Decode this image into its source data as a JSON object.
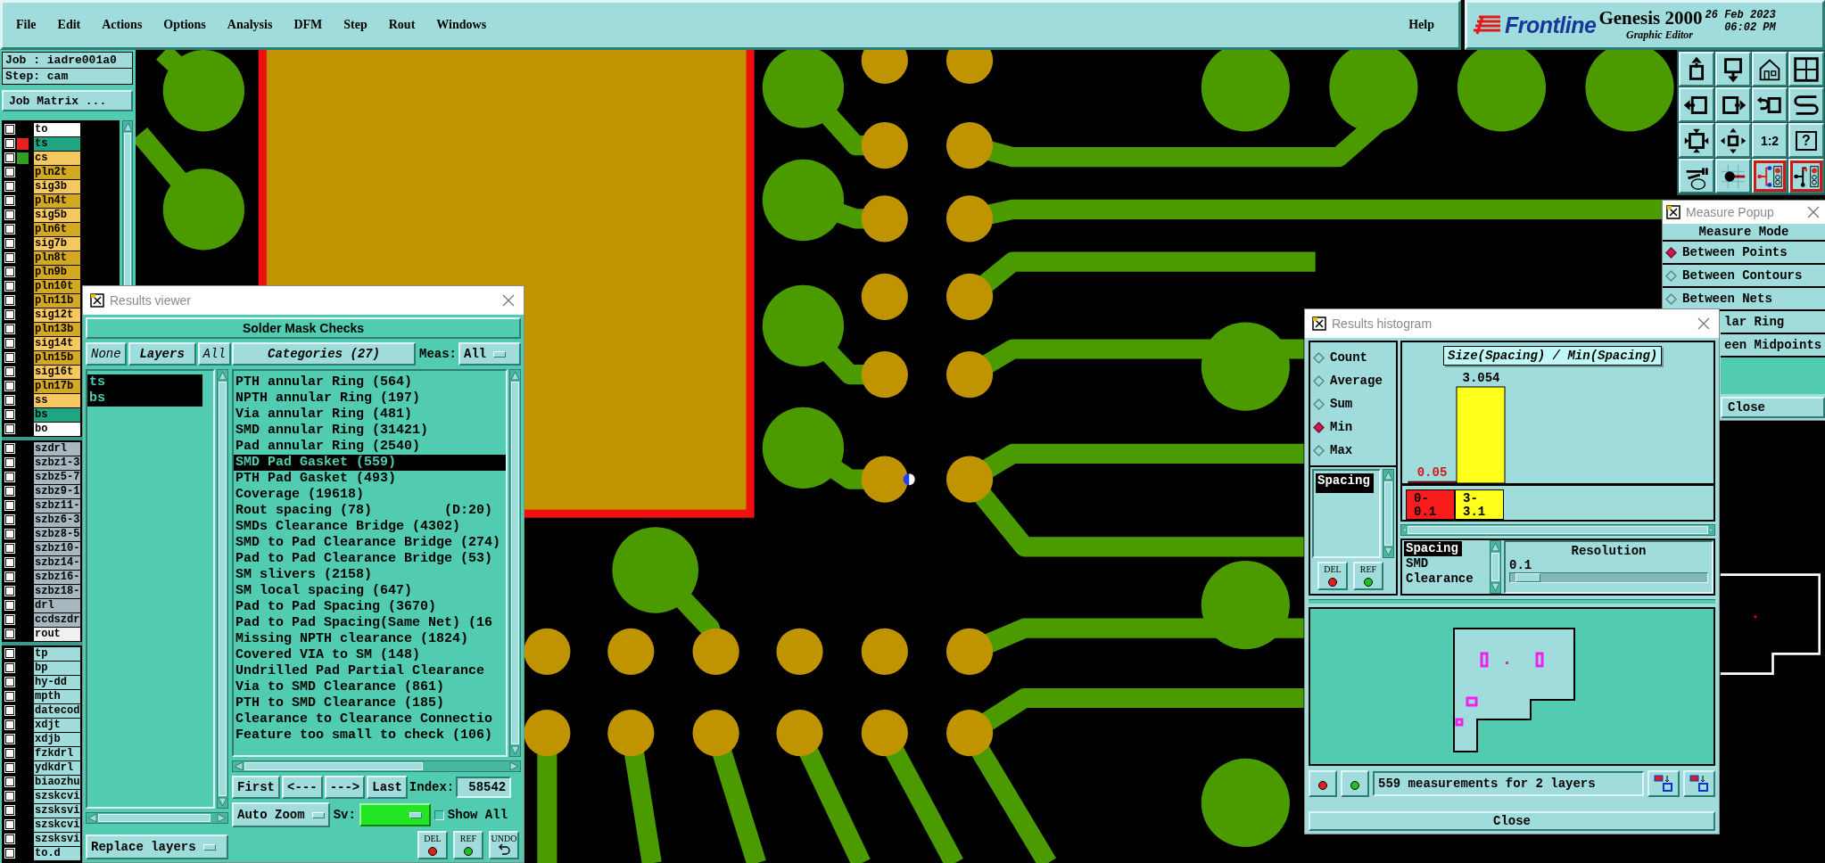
{
  "menubar": {
    "items": [
      "File",
      "Edit",
      "Actions",
      "Options",
      "Analysis",
      "DFM",
      "Step",
      "Rout",
      "Windows"
    ],
    "help": "Help"
  },
  "logo": {
    "brand": "Frontline",
    "product": "Genesis 2000",
    "subtitle": "Graphic Editor",
    "date": "26 Feb 2023",
    "time": "06:02 PM"
  },
  "job_panel": {
    "job": "Job : iadre001a0",
    "step": "Step: cam",
    "matrix_button": "Job Matrix ..."
  },
  "layer_groups": [
    {
      "layers": [
        {
          "name": "to",
          "color": "#ffffff",
          "checked": false
        },
        {
          "name": "ts",
          "color": "#1fa582",
          "checked": false,
          "display": {
            "color": "#e82020"
          }
        },
        {
          "name": "cs",
          "color": "#f8c860",
          "checked": false,
          "display": {
            "color": "#30a020"
          }
        },
        {
          "name": "pln2t",
          "color": "#d4a820",
          "checked": false
        },
        {
          "name": "sig3b",
          "color": "#f8c860",
          "checked": false
        },
        {
          "name": "pln4t",
          "color": "#d4a820",
          "checked": false
        },
        {
          "name": "sig5b",
          "color": "#f8c860",
          "checked": false
        },
        {
          "name": "pln6t",
          "color": "#d4a820",
          "checked": false
        },
        {
          "name": "sig7b",
          "color": "#f8c860",
          "checked": false
        },
        {
          "name": "pln8t",
          "color": "#d4a820",
          "checked": false
        },
        {
          "name": "pln9b",
          "color": "#d4a820",
          "checked": false
        },
        {
          "name": "pln10t",
          "color": "#d4a820",
          "checked": false
        },
        {
          "name": "pln11b",
          "color": "#d4a820",
          "checked": false
        },
        {
          "name": "sig12t",
          "color": "#f8c860",
          "checked": false
        },
        {
          "name": "pln13b",
          "color": "#d4a820",
          "checked": false
        },
        {
          "name": "sig14t",
          "color": "#f8c860",
          "checked": false
        },
        {
          "name": "pln15b",
          "color": "#d4a820",
          "checked": false
        },
        {
          "name": "sig16t",
          "color": "#f8c860",
          "checked": false
        },
        {
          "name": "pln17b",
          "color": "#d4a820",
          "checked": false
        },
        {
          "name": "ss",
          "color": "#f8c860",
          "checked": false
        },
        {
          "name": "bs",
          "color": "#1fa582",
          "checked": false
        },
        {
          "name": "bo",
          "color": "#ffffff",
          "checked": false
        }
      ]
    },
    {
      "layers": [
        {
          "name": "szdrl",
          "color": "#a8b8c0",
          "checked": false
        },
        {
          "name": "szbz1-3",
          "color": "#a8b8c0",
          "checked": false
        },
        {
          "name": "szbz5-7",
          "color": "#a8b8c0",
          "checked": false
        },
        {
          "name": "szbz9-1",
          "color": "#a8b8c0",
          "checked": false
        },
        {
          "name": "szbz11-",
          "color": "#a8b8c0",
          "checked": false
        },
        {
          "name": "szbz6-3",
          "color": "#a8b8c0",
          "checked": false
        },
        {
          "name": "szbz8-5",
          "color": "#a8b8c0",
          "checked": false
        },
        {
          "name": "szbz10-",
          "color": "#a8b8c0",
          "checked": false
        },
        {
          "name": "szbz14-",
          "color": "#a8b8c0",
          "checked": false
        },
        {
          "name": "szbz16-",
          "color": "#a8b8c0",
          "checked": false
        },
        {
          "name": "szbz18-",
          "color": "#a8b8c0",
          "checked": false
        },
        {
          "name": "drl",
          "color": "#a8b8c0",
          "checked": false
        },
        {
          "name": "ccdszdr",
          "color": "#a8b8c0",
          "checked": false
        },
        {
          "name": "rout",
          "color": "#f0f0f0",
          "checked": false
        }
      ]
    },
    {
      "layers": [
        {
          "name": "tp",
          "color": "#a0dcdc",
          "checked": false
        },
        {
          "name": "bp",
          "color": "#a0dcdc",
          "checked": false
        },
        {
          "name": "hy-dd",
          "color": "#a0dcdc",
          "checked": false
        },
        {
          "name": "mpth",
          "color": "#a0dcdc",
          "checked": false
        },
        {
          "name": "datecod",
          "color": "#a0dcdc",
          "checked": false
        },
        {
          "name": "xdjt",
          "color": "#a0dcdc",
          "checked": false
        },
        {
          "name": "xdjb",
          "color": "#a0dcdc",
          "checked": false
        },
        {
          "name": "fzkdrl",
          "color": "#a0dcdc",
          "checked": false
        },
        {
          "name": "ydkdrl",
          "color": "#a0dcdc",
          "checked": false
        },
        {
          "name": "biaozhu",
          "color": "#a0dcdc",
          "checked": false
        },
        {
          "name": "szskcvi",
          "color": "#a0dcdc",
          "checked": false
        },
        {
          "name": "szsksvi",
          "color": "#a0dcdc",
          "checked": false
        },
        {
          "name": "szskcvi",
          "color": "#a0dcdc",
          "checked": false
        },
        {
          "name": "szsksvi",
          "color": "#a0dcdc",
          "checked": false
        },
        {
          "name": "to.d",
          "color": "#a0dcdc",
          "checked": false
        }
      ]
    }
  ],
  "toolbar": [
    {
      "kind": "box-up"
    },
    {
      "kind": "box-down"
    },
    {
      "kind": "home"
    },
    {
      "kind": "grid"
    },
    {
      "kind": "box-left"
    },
    {
      "kind": "box-right"
    },
    {
      "kind": "return"
    },
    {
      "kind": "s-curve"
    },
    {
      "kind": "fit"
    },
    {
      "kind": "center"
    },
    {
      "kind": "ratio",
      "label": "1:2"
    },
    {
      "kind": "help",
      "label": "?"
    },
    {
      "kind": "tools"
    },
    {
      "kind": "pin"
    },
    {
      "kind": "net-color"
    },
    {
      "kind": "net-mono"
    }
  ],
  "results_viewer": {
    "title": "Results viewer",
    "heading": "Solder Mask Checks",
    "layer_buttons": [
      "None",
      "Layers",
      "All"
    ],
    "layers": [
      {
        "name": "ts",
        "selected": true
      },
      {
        "name": "bs",
        "selected": true
      }
    ],
    "categories_button": "Categories (27)",
    "meas": {
      "label": "Meas:",
      "value": "All"
    },
    "categories": [
      {
        "label": "PTH annular Ring (564)",
        "selected": false
      },
      {
        "label": "NPTH annular Ring (197)",
        "selected": false
      },
      {
        "label": "Via annular Ring (481)",
        "selected": false
      },
      {
        "label": "SMD annular Ring (31421)",
        "selected": false
      },
      {
        "label": "Pad annular Ring (2540)",
        "selected": false
      },
      {
        "label": "SMD Pad Gasket (559)",
        "selected": true
      },
      {
        "label": "PTH Pad Gasket (493)",
        "selected": false
      },
      {
        "label": "Coverage (19618)",
        "selected": false
      },
      {
        "label": "Rout spacing (78)         (D:20)",
        "selected": false
      },
      {
        "label": "SMDs Clearance Bridge (4302)",
        "selected": false
      },
      {
        "label": "SMD to Pad Clearance Bridge (274)",
        "selected": false
      },
      {
        "label": "Pad to Pad Clearance Bridge (53)",
        "selected": false
      },
      {
        "label": "SM slivers (2158)",
        "selected": false
      },
      {
        "label": "SM local spacing (647)",
        "selected": false
      },
      {
        "label": "Pad to Pad Spacing (3670)",
        "selected": false
      },
      {
        "label": "Pad to Pad Spacing(Same Net) (16",
        "selected": false
      },
      {
        "label": "Missing NPTH clearance (1824)",
        "selected": false
      },
      {
        "label": "Covered VIA to SM (148)",
        "selected": false
      },
      {
        "label": "Undrilled Pad Partial Clearance",
        "selected": false
      },
      {
        "label": "Via to SMD Clearance (861)",
        "selected": false
      },
      {
        "label": "PTH to SMD Clearance (185)",
        "selected": false
      },
      {
        "label": "Clearance to Clearance Connectio",
        "selected": false
      },
      {
        "label": "Feature too small to check (106)",
        "selected": false
      }
    ],
    "nav": [
      "First",
      "<---",
      "--->",
      "Last"
    ],
    "index": {
      "label": "Index:",
      "value": "58542"
    },
    "zoom": "Auto Zoom",
    "sv": {
      "label": "Sv:",
      "color": "#22e622"
    },
    "show_all": {
      "label": "Show All",
      "checked": false
    },
    "replace": "Replace layers",
    "actions": [
      {
        "kind": "del",
        "label": "DEL"
      },
      {
        "kind": "ref",
        "label": "REF"
      },
      {
        "kind": "undo",
        "label": "UNDO"
      }
    ]
  },
  "results_histogram": {
    "title": "Results histogram",
    "modes": [
      {
        "label": "Count",
        "selected": false
      },
      {
        "label": "Average",
        "selected": false
      },
      {
        "label": "Sum",
        "selected": false
      },
      {
        "label": "Min",
        "selected": true
      },
      {
        "label": "Max",
        "selected": false
      }
    ],
    "measures": [
      {
        "label": "Spacing",
        "selected": true
      }
    ],
    "side_actions": [
      {
        "kind": "del",
        "label": "DEL"
      },
      {
        "kind": "ref",
        "label": "REF"
      }
    ],
    "chart": {
      "title": "Size(Spacing) / Min(Spacing)",
      "bins": [
        {
          "color": "#f81c1c"
        },
        {
          "color": "#ffff1c"
        }
      ],
      "chart_data": {
        "type": "bar",
        "categories": [
          "0- 0.1",
          "3- 3.1"
        ],
        "series": [
          {
            "values": [
              0.05,
              3.054
            ]
          }
        ],
        "data_labels": true
      }
    },
    "types": [
      {
        "label": "Spacing",
        "selected": true
      },
      {
        "label": "SMD",
        "selected": false
      },
      {
        "label": "Clearance",
        "selected": false
      }
    ],
    "resolution": {
      "title": "Resolution",
      "value": "0.1",
      "level": 0.03
    },
    "status": "559 measurements for 2 layers",
    "close": "Close"
  },
  "measure_popup": {
    "title": "Measure Popup",
    "heading": "Measure Mode",
    "modes": [
      {
        "label": "Between Points",
        "selected": true,
        "clipped": false
      },
      {
        "label": "Between Contours",
        "selected": false,
        "clipped": false
      },
      {
        "label": "Between Nets",
        "selected": false,
        "clipped": false
      },
      {
        "label": "lar Ring",
        "clipped": true
      },
      {
        "label": "een Midpoints",
        "clipped": true
      }
    ],
    "close": "Close"
  }
}
